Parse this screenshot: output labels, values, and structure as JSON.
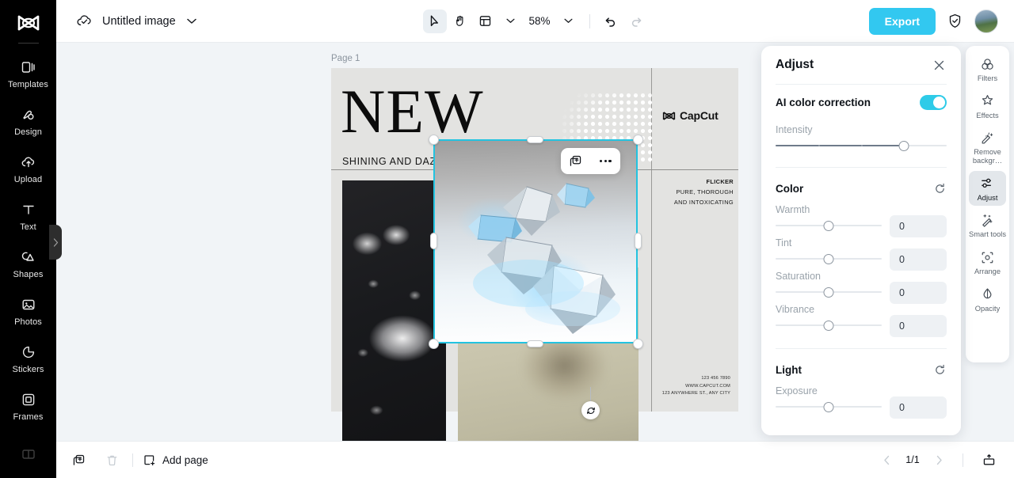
{
  "app": {
    "brand_icon": "capcut-logo-icon"
  },
  "left_sidebar": {
    "items": [
      {
        "label": "Templates",
        "icon": "templates-icon"
      },
      {
        "label": "Design",
        "icon": "design-icon"
      },
      {
        "label": "Upload",
        "icon": "upload-cloud-icon"
      },
      {
        "label": "Text",
        "icon": "text-icon"
      },
      {
        "label": "Shapes",
        "icon": "shapes-icon"
      },
      {
        "label": "Photos",
        "icon": "photos-icon"
      },
      {
        "label": "Stickers",
        "icon": "stickers-icon"
      },
      {
        "label": "Frames",
        "icon": "frames-icon"
      }
    ],
    "collapse_icon": "chevron-right-icon"
  },
  "topbar": {
    "cloud_icon": "cloud-saved-icon",
    "project_title": "Untitled image",
    "title_caret_icon": "chevron-down-icon",
    "tools": [
      {
        "name": "select-tool",
        "icon": "cursor-arrow-icon",
        "active": true
      },
      {
        "name": "hand-tool",
        "icon": "hand-icon",
        "active": false
      },
      {
        "name": "layout-tool",
        "icon": "layout-grid-icon",
        "active": false
      }
    ],
    "layout_caret_icon": "chevron-down-icon",
    "zoom_level": "58%",
    "zoom_caret_icon": "chevron-down-icon",
    "undo_icon": "undo-arrow-icon",
    "redo_icon": "redo-arrow-icon",
    "export_label": "Export",
    "shield_icon": "shield-check-icon",
    "avatar_icon": "user-avatar"
  },
  "canvas": {
    "page_label": "Page 1",
    "design": {
      "headline": "NEW",
      "subhead": "SHINING AND DAZZLING",
      "brand_text": "CapCut",
      "brand_icon": "capcut-logo-icon",
      "flicker_lines": [
        "FLICKER",
        "PURE, THOROUGH",
        "AND INTOXICATING"
      ],
      "contact_lines": [
        "123 456 7890",
        "WWW.CAPCUT.COM",
        "123 ANYWHERE ST., ANY CITY"
      ]
    },
    "selection": {
      "float_toolbar": [
        {
          "name": "duplicate-layer-button",
          "icon": "duplicate-icon"
        },
        {
          "name": "more-options-button",
          "icon": "more-horizontal-icon"
        }
      ],
      "rotate_icon": "rotate-icon"
    }
  },
  "adjust_panel": {
    "title": "Adjust",
    "close_icon": "close-icon",
    "ai_color_correction": {
      "label": "AI color correction",
      "enabled": true
    },
    "intensity": {
      "label": "Intensity",
      "percent": 75
    },
    "sections": [
      {
        "title": "Color",
        "reset_icon": "reset-icon",
        "sliders": [
          {
            "label": "Warmth",
            "value": "0",
            "percent": 50
          },
          {
            "label": "Tint",
            "value": "0",
            "percent": 50
          },
          {
            "label": "Saturation",
            "value": "0",
            "percent": 50
          },
          {
            "label": "Vibrance",
            "value": "0",
            "percent": 50
          }
        ]
      },
      {
        "title": "Light",
        "reset_icon": "reset-icon",
        "sliders": [
          {
            "label": "Exposure",
            "value": "0",
            "percent": 50
          }
        ]
      }
    ]
  },
  "right_sidebar": {
    "items": [
      {
        "label": "Filters",
        "icon": "filters-icon",
        "active": false
      },
      {
        "label": "Effects",
        "icon": "effects-star-icon",
        "active": false
      },
      {
        "label": "Remove backgr…",
        "icon": "remove-background-icon",
        "active": false
      },
      {
        "label": "Adjust",
        "icon": "adjust-sliders-icon",
        "active": true
      },
      {
        "label": "Smart tools",
        "icon": "smart-tools-wand-icon",
        "active": false
      },
      {
        "label": "Arrange",
        "icon": "arrange-icon",
        "active": false
      },
      {
        "label": "Opacity",
        "icon": "opacity-drop-icon",
        "active": false
      }
    ]
  },
  "bottombar": {
    "duplicate_page_icon": "duplicate-page-icon",
    "delete_page_icon": "trash-icon",
    "add_page_label": "Add page",
    "add_page_icon": "add-page-icon",
    "prev_icon": "chevron-left-icon",
    "page_indicator": "1/1",
    "next_icon": "chevron-right-icon",
    "present_icon": "present-icon"
  },
  "colors": {
    "accent": "#32c8f0",
    "selection": "#23c3e0",
    "toggle_on": "#2ecbe8",
    "rail_bg": "#000000",
    "workspace_bg": "#f1f4f7"
  }
}
